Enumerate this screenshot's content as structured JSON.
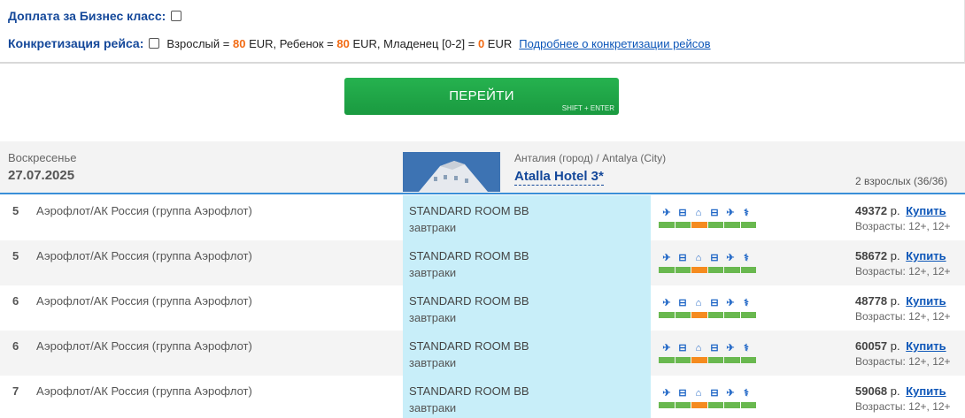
{
  "options": {
    "business": {
      "label": "Доплата за Бизнес класс:"
    },
    "flight_spec": {
      "label": "Конкретизация рейса:",
      "adult_text": "Взрослый =",
      "adult_value": "80",
      "child_text": "EUR, Ребенок =",
      "child_value": "80",
      "infant_text": "EUR, Младенец [0-2] =",
      "infant_value": "0",
      "currency": "EUR",
      "more_link": "Подробнее о конкретизации рейсов"
    }
  },
  "go_button": {
    "label": "ПЕРЕЙТИ",
    "hint": "SHIFT + ENTER"
  },
  "tour": {
    "day": "Воскресенье",
    "date": "27.07.2025",
    "city": "Анталия (город) / Antalya (City)",
    "hotel": "Atalla Hotel 3*",
    "pax": "2 взрослых (36/36)"
  },
  "service_icons": [
    "plane-icon",
    "bus-icon",
    "hotel-icon",
    "bus-icon",
    "plane-icon",
    "medical-insurance-icon"
  ],
  "colors": {
    "accent_blue": "#14489a",
    "go_green": "#1fa647",
    "room_bg": "#c8eef9",
    "price_orange": "#f26b14",
    "bar_green": "#69b84f",
    "bar_orange": "#f58b1f"
  },
  "rows": [
    {
      "nights": "5",
      "airline": "Аэрофлот/АК Россия (группа Аэрофлот)",
      "room": "STANDARD ROOM BB",
      "meal": "завтраки",
      "price": "49372",
      "currency": "р.",
      "buy": "Купить",
      "ages": "Возрасты: 12+, 12+"
    },
    {
      "nights": "5",
      "airline": "Аэрофлот/АК Россия (группа Аэрофлот)",
      "room": "STANDARD ROOM BB",
      "meal": "завтраки",
      "price": "58672",
      "currency": "р.",
      "buy": "Купить",
      "ages": "Возрасты: 12+, 12+"
    },
    {
      "nights": "6",
      "airline": "Аэрофлот/АК Россия (группа Аэрофлот)",
      "room": "STANDARD ROOM BB",
      "meal": "завтраки",
      "price": "48778",
      "currency": "р.",
      "buy": "Купить",
      "ages": "Возрасты: 12+, 12+"
    },
    {
      "nights": "6",
      "airline": "Аэрофлот/АК Россия (группа Аэрофлот)",
      "room": "STANDARD ROOM BB",
      "meal": "завтраки",
      "price": "60057",
      "currency": "р.",
      "buy": "Купить",
      "ages": "Возрасты: 12+, 12+"
    },
    {
      "nights": "7",
      "airline": "Аэрофлот/АК Россия (группа Аэрофлот)",
      "room": "STANDARD ROOM BB",
      "meal": "завтраки",
      "price": "59068",
      "currency": "р.",
      "buy": "Купить",
      "ages": "Возрасты: 12+, 12+"
    }
  ]
}
